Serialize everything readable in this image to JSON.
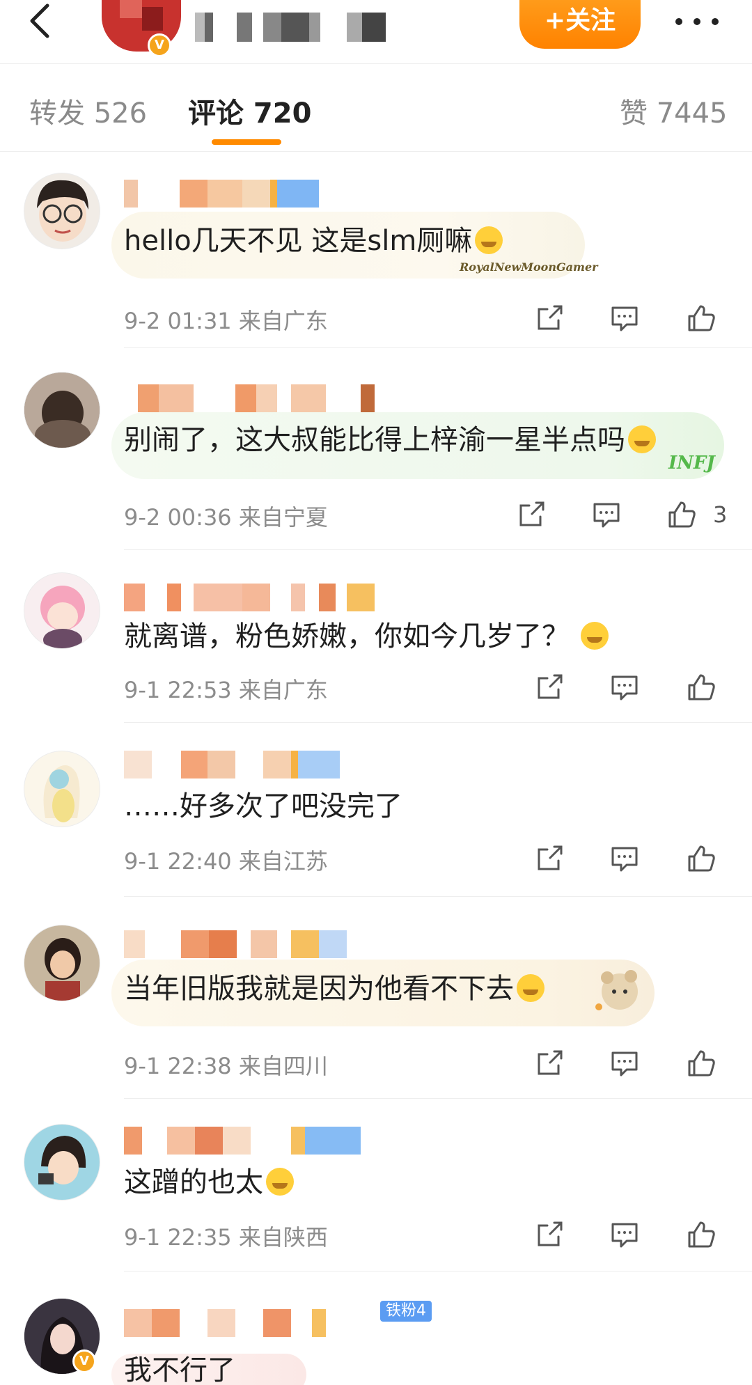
{
  "header": {
    "back_icon": "chevron-left-icon",
    "follow_label": "+关注",
    "more_icon": "more-dots-icon",
    "verified_badge": "V"
  },
  "tabs": [
    {
      "label": "转发 526",
      "active": false
    },
    {
      "label": "评论 720",
      "active": true
    },
    {
      "label": "赞 7445",
      "active": false
    }
  ],
  "comments": [
    {
      "text": "hello几天不见 这是slm厕嘛",
      "emoji": "laugh-cry",
      "meta": "9-2 01:31 来自广东",
      "likes": "",
      "decoration": "RoyalNewMoonGamer"
    },
    {
      "text": "别闹了，这大叔能比得上梓渝一星半点吗",
      "emoji": "thinking",
      "meta": "9-2 00:36 来自宁夏",
      "likes": "3",
      "decoration": "INFJ"
    },
    {
      "text": "就离谱，粉色娇嫩，你如今几岁了？",
      "emoji": "thinking",
      "meta": "9-1 22:53 来自广东",
      "likes": "",
      "decoration": ""
    },
    {
      "text": "……好多次了吧没完了",
      "emoji": "",
      "meta": "9-1 22:40 来自江苏",
      "likes": "",
      "decoration": ""
    },
    {
      "text": "当年旧版我就是因为他看不下去",
      "emoji": "thinking",
      "meta": "9-1 22:38 来自四川",
      "likes": "",
      "decoration": "bear"
    },
    {
      "text": "这蹭的也太",
      "emoji": "laugh-cry",
      "meta": "9-1 22:35 来自陕西",
      "likes": "",
      "decoration": ""
    },
    {
      "text": "我不行了",
      "emoji": "",
      "meta": "",
      "likes": "",
      "decoration": "",
      "badge": "铁粉4"
    }
  ],
  "actions": {
    "share_icon": "share-icon",
    "comment_icon": "comment-icon",
    "like_icon": "thumbs-up-icon"
  },
  "colors": {
    "accent": "#ff8a00",
    "follow_button": "#ff8a00",
    "meta_text": "#8c8c8c",
    "fan_badge": "#5b9cf2"
  }
}
